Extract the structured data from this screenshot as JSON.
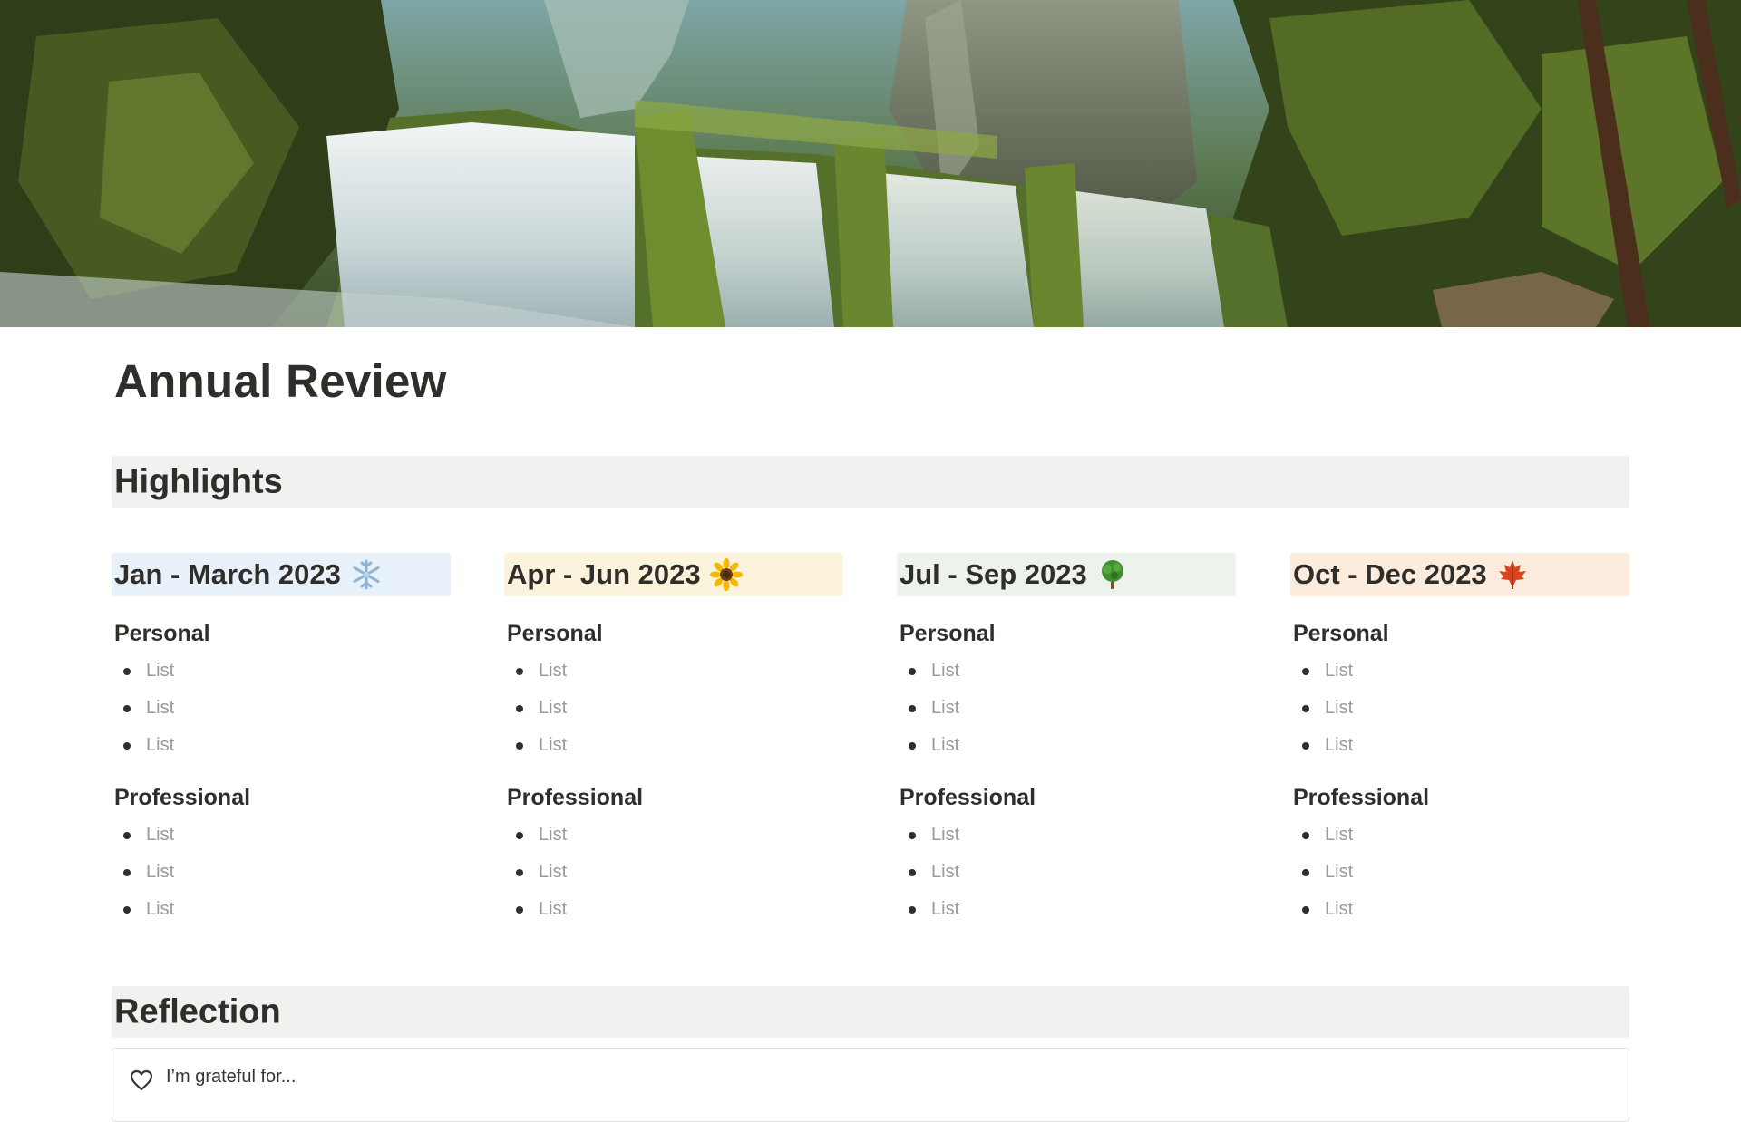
{
  "page": {
    "title": "Annual Review"
  },
  "sections": {
    "highlights": "Highlights",
    "reflection": "Reflection"
  },
  "quarters": [
    {
      "title": "Jan - March 2023",
      "emoji": "snowflake-icon",
      "bg": "#e8f1f9",
      "personal_label": "Personal",
      "personal_items": [
        "List",
        "List",
        "List"
      ],
      "professional_label": "Professional",
      "professional_items": [
        "List",
        "List",
        "List"
      ]
    },
    {
      "title": "Apr - Jun 2023",
      "emoji": "sunflower-icon",
      "bg": "#fbf3db",
      "personal_label": "Personal",
      "personal_items": [
        "List",
        "List",
        "List"
      ],
      "professional_label": "Professional",
      "professional_items": [
        "List",
        "List",
        "List"
      ]
    },
    {
      "title": "Jul - Sep 2023",
      "emoji": "tree-icon",
      "bg": "#edf3ec",
      "personal_label": "Personal",
      "personal_items": [
        "List",
        "List",
        "List"
      ],
      "professional_label": "Professional",
      "professional_items": [
        "List",
        "List",
        "List"
      ]
    },
    {
      "title": "Oct - Dec 2023",
      "emoji": "maple-leaf-icon",
      "bg": "#fbecdd",
      "personal_label": "Personal",
      "personal_items": [
        "List",
        "List",
        "List"
      ],
      "professional_label": "Professional",
      "professional_items": [
        "List",
        "List",
        "List"
      ]
    }
  ],
  "reflection": {
    "callout_icon": "heart-icon",
    "callout_text": "I’m grateful for..."
  }
}
